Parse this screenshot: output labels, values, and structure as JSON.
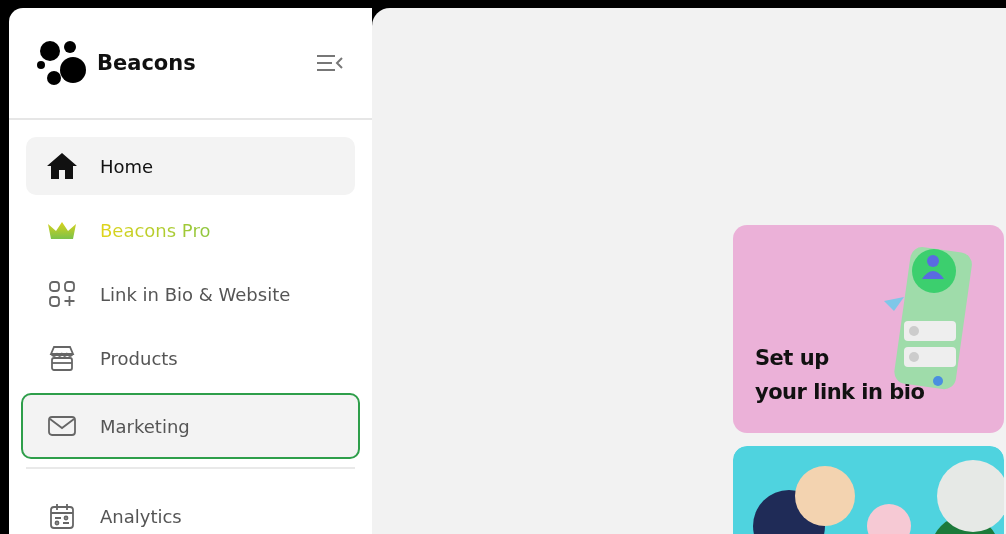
{
  "sidebar": {
    "brand": "Beacons",
    "nav_groups": [
      [
        {
          "label": "Home",
          "kind": "regular",
          "selected": true,
          "focused": false
        },
        {
          "label": "Beacons Pro",
          "kind": "pro",
          "selected": false,
          "focused": false
        },
        {
          "label": "Link in Bio & Website",
          "kind": "regular",
          "selected": false,
          "focused": false
        },
        {
          "label": "Products",
          "kind": "regular",
          "selected": false,
          "focused": false
        },
        {
          "label": "Marketing",
          "kind": "regular",
          "selected": false,
          "focused": true
        }
      ],
      [
        {
          "label": "Analytics",
          "kind": "regular",
          "selected": false,
          "focused": false
        }
      ]
    ]
  },
  "cards": [
    {
      "kind": "link-in-bio",
      "title": "Set up\nyour link in bio"
    },
    {
      "kind": "brands"
    }
  ]
}
